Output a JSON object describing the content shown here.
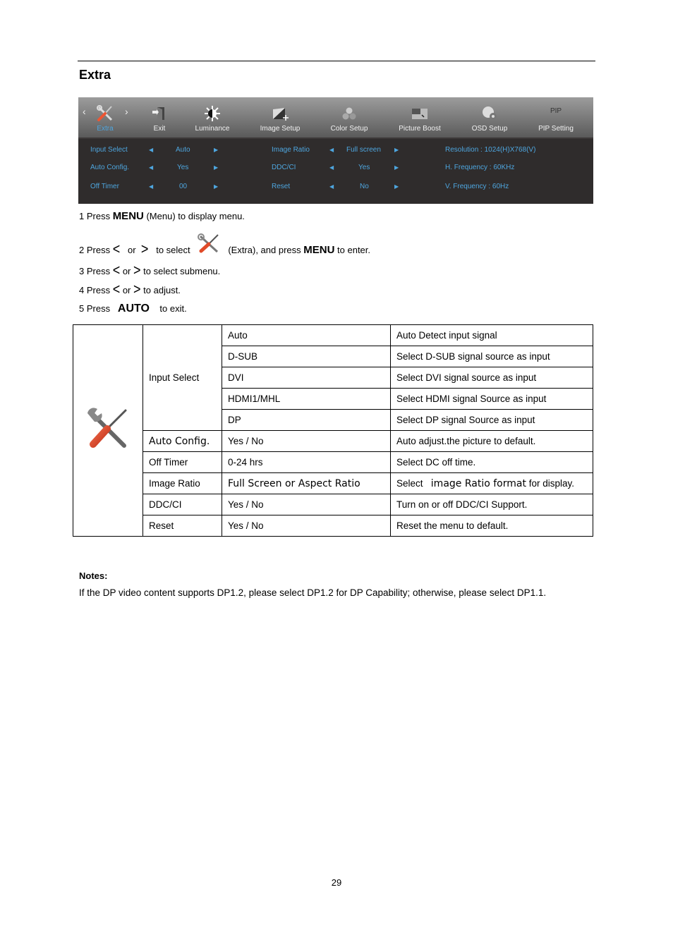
{
  "section_title": "Extra",
  "osd": {
    "tabs": [
      {
        "label": "Extra",
        "icon": "tools-icon",
        "active": true
      },
      {
        "label": "Exit",
        "icon": "exit-icon"
      },
      {
        "label": "Luminance",
        "icon": "luminance-icon"
      },
      {
        "label": "Image Setup",
        "icon": "image-setup-icon"
      },
      {
        "label": "Color Setup",
        "icon": "color-setup-icon"
      },
      {
        "label": "Picture Boost",
        "icon": "picture-boost-icon"
      },
      {
        "label": "OSD Setup",
        "icon": "osd-setup-icon"
      },
      {
        "label": "PIP Setting",
        "icon": "pip-icon",
        "icon_text": "PIP"
      }
    ],
    "left_settings": [
      {
        "label": "Input Select",
        "value": "Auto"
      },
      {
        "label": "Auto Config.",
        "value": "Yes"
      },
      {
        "label": "Off Timer",
        "value": "00"
      }
    ],
    "mid_settings": [
      {
        "label": "Image Ratio",
        "value": "Full screen"
      },
      {
        "label": "DDC/CI",
        "value": "Yes"
      },
      {
        "label": "Reset",
        "value": "No"
      }
    ],
    "info": [
      "Resolution : 1024(H)X768(V)",
      "H. Frequency : 60KHz",
      "V. Frequency : 60Hz"
    ],
    "accent_color": "#4ea6df"
  },
  "steps": {
    "s1": {
      "pre": "1 Press ",
      "key": "MENU",
      "post": " (Menu) to display menu."
    },
    "s2": {
      "pre": "2 Press ",
      "or": "or",
      "mid": "to select",
      "post": "(Extra), and press ",
      "key": "MENU",
      "end": " to enter."
    },
    "s3": {
      "pre": "3 Press ",
      "or": "or",
      "post": "to select submenu."
    },
    "s4": {
      "pre": "4 Press ",
      "or": "or",
      "post": "to adjust."
    },
    "s5": {
      "pre": "5 Press",
      "key": "AUTO",
      "post": "to exit."
    },
    "left_glyph": "<",
    "right_glyph": ">"
  },
  "table": {
    "input_select": {
      "label": "Input Select",
      "options": [
        {
          "value": "Auto",
          "desc": "Auto Detect input signal"
        },
        {
          "value": "D-SUB",
          "desc": "Select D-SUB signal source as input"
        },
        {
          "value": "DVI",
          "desc": "Select DVI signal source as input"
        },
        {
          "value": "HDMI1/MHL",
          "desc": "Select HDMI signal Source as input"
        },
        {
          "value": "DP",
          "desc": "Select DP signal Source as input"
        }
      ]
    },
    "rows": [
      {
        "item": "Auto Config.",
        "value": "Yes / No",
        "desc": "Auto adjust.the picture to default."
      },
      {
        "item": "Off Timer",
        "value": "0-24 hrs",
        "desc": "Select DC off time."
      },
      {
        "item": "Image Ratio",
        "value": "Full Screen or Aspect Ratio",
        "desc_pre": "Select",
        "desc_mid": "image Ratio format",
        "desc_post": "for display."
      },
      {
        "item": "DDC/CI",
        "value": "Yes / No",
        "desc": "Turn on or off DDC/CI Support."
      },
      {
        "item": "Reset",
        "value": "Yes / No",
        "desc": "Reset the menu to default."
      }
    ]
  },
  "notes": {
    "heading": "Notes:",
    "text": "If the DP video content supports DP1.2, please select DP1.2 for DP Capability; otherwise, please select DP1.1."
  },
  "page_number": "29"
}
